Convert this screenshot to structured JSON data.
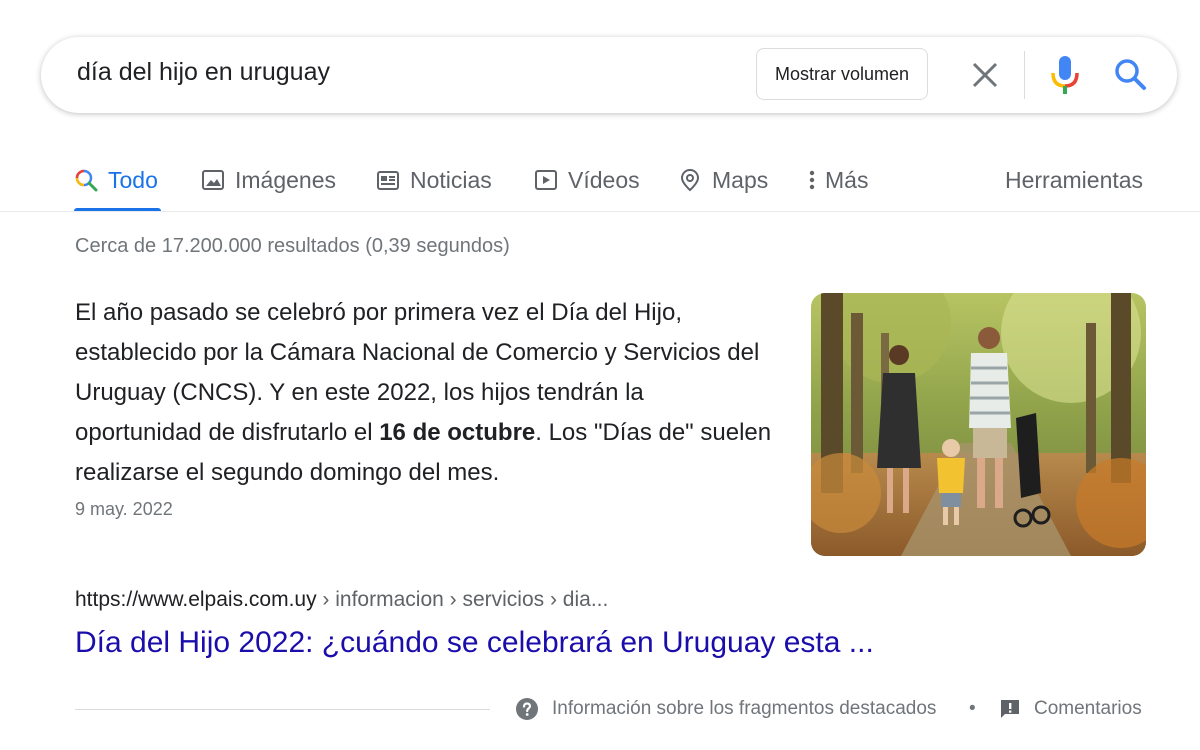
{
  "search": {
    "query": "día del hijo en uruguay",
    "volume_button": "Mostrar volumen",
    "icons": {
      "clear": "close-icon",
      "mic": "mic-icon",
      "search": "search-icon"
    }
  },
  "tabs": [
    {
      "label": "Todo",
      "icon": "search-icon",
      "active": true
    },
    {
      "label": "Imágenes",
      "icon": "image-icon"
    },
    {
      "label": "Noticias",
      "icon": "news-icon"
    },
    {
      "label": "Vídeos",
      "icon": "play-icon"
    },
    {
      "label": "Maps",
      "icon": "map-pin-icon"
    },
    {
      "label": "Más",
      "icon": "more-vert-icon"
    }
  ],
  "tools_label": "Herramientas",
  "result_stats": "Cerca de 17.200.000 resultados (0,39 segundos)",
  "featured_snippet": {
    "text_before": "El año pasado se celebró por primera vez el Día del Hijo, establecido por la Cámara Nacional de Comercio y Servicios del Uruguay (CNCS). Y en este 2022, los hijos tendrán la oportunidad de disfrutarlo el ",
    "text_bold": "16 de octubre",
    "text_after": ". Los \"Días de\" suelen realizarse el segundo domingo del mes.",
    "date": "9 may. 2022",
    "image": "family-walking-park-photo"
  },
  "result": {
    "url_domain": "https://www.elpais.com.uy",
    "url_path": " › informacion › servicios › dia...",
    "title": "Día del Hijo 2022: ¿cuándo se celebrará en Uruguay esta ..."
  },
  "footer": {
    "about_label": "Información sobre los fragmentos destacados",
    "separator": "•",
    "feedback_label": "Comentarios"
  },
  "colors": {
    "accent": "#1a73e8",
    "link": "#1a0dab",
    "muted": "#70757a"
  }
}
